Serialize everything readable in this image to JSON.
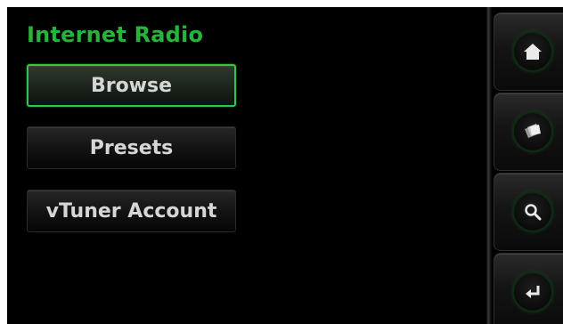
{
  "header": {
    "title": "Internet Radio"
  },
  "menu": {
    "items": [
      {
        "label": "Browse",
        "selected": true
      },
      {
        "label": "Presets",
        "selected": false
      },
      {
        "label": "vTuner Account",
        "selected": false
      }
    ]
  },
  "side_nav": {
    "icons": [
      "home-icon",
      "media-library-icon",
      "search-icon",
      "back-enter-icon"
    ]
  },
  "colors": {
    "accent": "#27b43a",
    "selected_border": "#33c24a",
    "background": "#000000",
    "text": "#d6d6d6"
  }
}
